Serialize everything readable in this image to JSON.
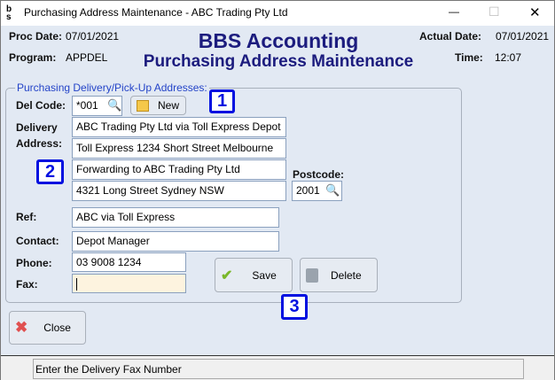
{
  "window": {
    "title": "Purchasing Address Maintenance - ABC Trading Pty Ltd",
    "minimize": "—",
    "maximize": "☐",
    "close": "✕"
  },
  "header": {
    "proc_date_label": "Proc Date:",
    "proc_date": "07/01/2021",
    "program_label": "Program:",
    "program": "APPDEL",
    "title": "BBS Accounting",
    "subtitle": "Purchasing Address Maintenance",
    "actual_date_label": "Actual Date:",
    "actual_date": "07/01/2021",
    "time_label": "Time:",
    "time": "12:07"
  },
  "group": {
    "legend": "Purchasing Delivery/Pick-Up Addresses:"
  },
  "form": {
    "del_code_label": "Del Code:",
    "del_code": "*001",
    "new_label": "New",
    "delivery_label": "Delivery",
    "address_label": "Address:",
    "address_lines": [
      "ABC Trading Pty Ltd via Toll Express Depot",
      "Toll Express 1234 Short Street Melbourne",
      "Forwarding to ABC Trading Pty Ltd",
      "4321 Long Street Sydney NSW"
    ],
    "postcode_label": "Postcode:",
    "postcode": "2001",
    "ref_label": "Ref:",
    "ref": "ABC via Toll Express",
    "contact_label": "Contact:",
    "contact": "Depot Manager",
    "phone_label": "Phone:",
    "phone": "03 9008 1234",
    "fax_label": "Fax:",
    "fax": ""
  },
  "buttons": {
    "save": "Save",
    "delete": "Delete",
    "close": "Close"
  },
  "badges": [
    "1",
    "2",
    "3"
  ],
  "status": {
    "message": "Enter the Delivery Fax Number"
  }
}
